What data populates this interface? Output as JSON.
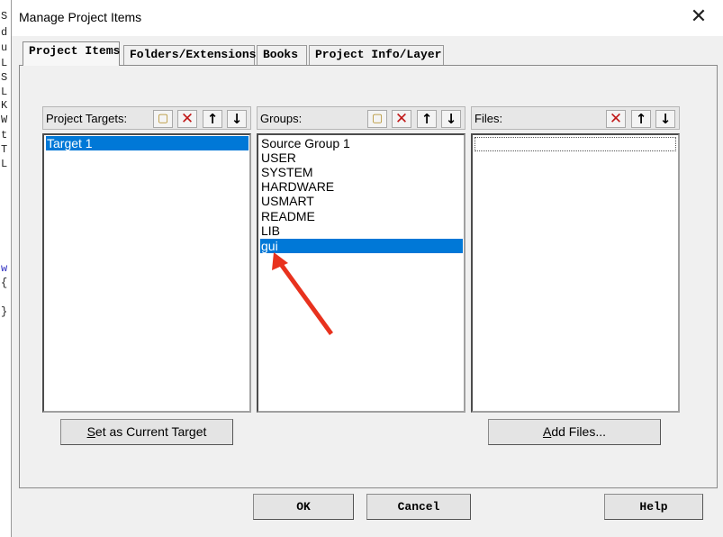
{
  "background_text": [
    "S",
    "d",
    "u",
    "L",
    "S",
    "L",
    "K",
    "W",
    "t",
    "T",
    "L",
    "w",
    "{",
    "}"
  ],
  "dialog": {
    "title": "Manage Project Items",
    "close_glyph": "✕"
  },
  "tabs": [
    {
      "label": "Project Items",
      "active": true
    },
    {
      "label": "Folders/Extensions",
      "active": false
    },
    {
      "label": "Books",
      "active": false
    },
    {
      "label": "Project Info/Layer",
      "active": false
    }
  ],
  "project_targets": {
    "header": "Project Targets:",
    "items": [
      "Target 1"
    ],
    "selected": "Target 1",
    "button_label": "Set as Current Target",
    "button_mnemonic": "S"
  },
  "groups": {
    "header": "Groups:",
    "items": [
      "Source Group 1",
      "USER",
      "SYSTEM",
      "HARDWARE",
      "USMART",
      "README",
      "LIB",
      "gui"
    ],
    "selected": "gui"
  },
  "files": {
    "header": "Files:",
    "items": [],
    "button_label": "Add Files...",
    "button_mnemonic": "A"
  },
  "toolbar_icons": {
    "new": "new-item-icon",
    "delete": "delete-icon",
    "up": "move-up-icon",
    "down": "move-down-icon"
  },
  "footer": {
    "ok": "OK",
    "cancel": "Cancel",
    "help": "Help"
  },
  "colors": {
    "selection": "#0078d7",
    "annotation_arrow": "#e8321e",
    "delete_icon": "#c01818"
  }
}
